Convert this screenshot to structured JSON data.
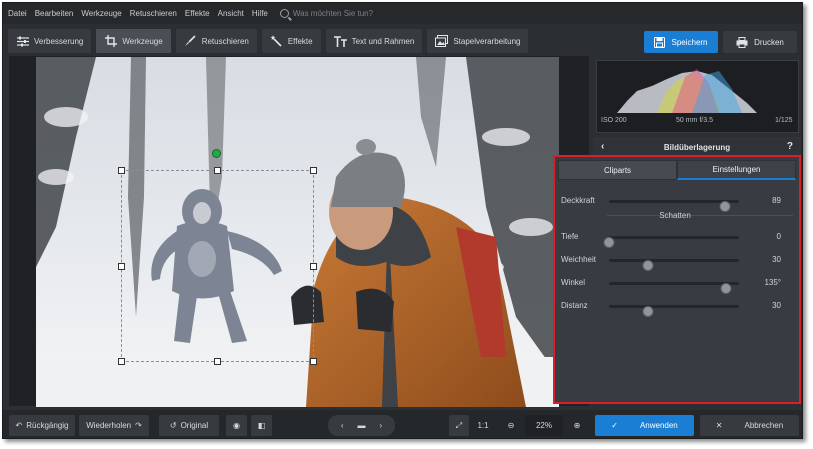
{
  "menu": {
    "items": [
      "Datei",
      "Bearbeiten",
      "Werkzeuge",
      "Retuschieren",
      "Effekte",
      "Ansicht",
      "Hilfe"
    ],
    "search_placeholder": "Was möchten Sie tun?"
  },
  "tool_tabs": [
    {
      "label": "Verbesserung",
      "icon": "sliders-icon",
      "active": false
    },
    {
      "label": "Werkzeuge",
      "icon": "crop-icon",
      "active": true
    },
    {
      "label": "Retuschieren",
      "icon": "brush-icon",
      "active": false
    },
    {
      "label": "Effekte",
      "icon": "magic-wand-icon",
      "active": false
    },
    {
      "label": "Text und Rahmen",
      "icon": "text-icon",
      "active": false
    },
    {
      "label": "Stapelverarbeitung",
      "icon": "batch-icon",
      "active": false
    }
  ],
  "top_actions": {
    "save_label": "Speichern",
    "print_label": "Drucken"
  },
  "histogram": {
    "iso": "ISO 200",
    "lens": "50 mm f/3.5",
    "shutter": "1/125"
  },
  "panel": {
    "title": "Bildüberlagerung"
  },
  "settings": {
    "tabs": [
      {
        "label": "Cliparts",
        "active": false
      },
      {
        "label": "Einstellungen",
        "active": true
      }
    ],
    "opacity": {
      "label": "Deckkraft",
      "value": "89",
      "fraction": 0.89
    },
    "shadow_title": "Schatten",
    "shadow": [
      {
        "label": "Tiefe",
        "value": "0",
        "fraction": 0.0
      },
      {
        "label": "Weichheit",
        "value": "30",
        "fraction": 0.3
      },
      {
        "label": "Winkel",
        "value": "135°",
        "fraction": 0.9
      },
      {
        "label": "Distanz",
        "value": "30",
        "fraction": 0.3
      }
    ]
  },
  "bottom": {
    "undo": "Rückgängig",
    "redo": "Wiederholen",
    "original": "Original",
    "ratio": "1:1",
    "zoom": "22%",
    "apply": "Anwenden",
    "cancel": "Abbrechen"
  },
  "colors": {
    "accent": "#1a7fd4",
    "highlight_border": "#d8202a",
    "selection_handle": "#22aa44"
  }
}
